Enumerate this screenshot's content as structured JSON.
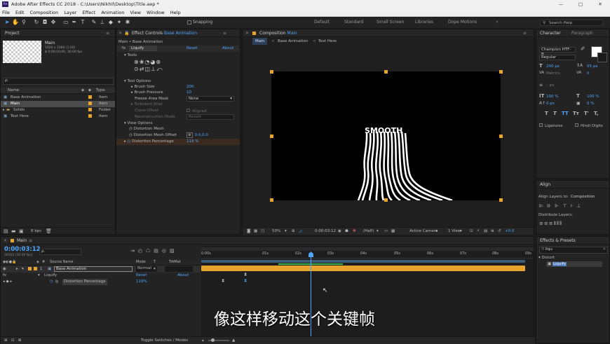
{
  "app": {
    "icon": "Ae",
    "title": "Adobe After Effects CC 2018 - C:\\Users\\Nikhil\\Desktop\\Title.aep *",
    "window_controls": {
      "minimize": "—",
      "maximize": "□",
      "close": "✕"
    }
  },
  "menu": [
    "File",
    "Edit",
    "Composition",
    "Layer",
    "Effect",
    "Animation",
    "View",
    "Window",
    "Help"
  ],
  "toolbar": {
    "tools": [
      "selection-arrow",
      "hand",
      "zoom",
      "rotate",
      "camera",
      "pan-behind",
      "rectangle",
      "pen",
      "type",
      "brush",
      "clone-stamp",
      "eraser",
      "roto-brush",
      "puppet"
    ],
    "snapping": "Snapping",
    "workspaces": [
      {
        "label": "Default",
        "active": false
      },
      {
        "label": "Standard",
        "active": false
      },
      {
        "label": "Small Screen",
        "active": false
      },
      {
        "label": "Libraries",
        "active": false
      },
      {
        "label": "Dope Motions",
        "active": false
      }
    ],
    "search_placeholder": "Search Help"
  },
  "project": {
    "tab": "Project",
    "item_name": "Main",
    "item_info1": "1920 x 1080 (1.00)",
    "item_info2": "Δ 0;00;10;00, 30.00 fps",
    "search_placeholder": "ρ.",
    "col_name": "Name",
    "col_type": "Type",
    "items": [
      {
        "name": "Base Animation",
        "type": "Item",
        "selected": false
      },
      {
        "name": "Main",
        "type": "Item",
        "selected": true
      },
      {
        "name": "Solids",
        "type": "Folder",
        "selected": false
      },
      {
        "name": "Text Here",
        "type": "Item",
        "selected": false
      }
    ],
    "bpc": "8 bpc"
  },
  "effect_controls": {
    "tab_prefix": "Effect Controls",
    "tab_layer": "Base Animation",
    "breadcrumb": "Main • Base Animation",
    "effect_name": "Liquify",
    "reset": "Reset",
    "about": "About",
    "tools_label": "Tools",
    "tool_options_label": "Tool Options",
    "brush_size_label": "Brush Size",
    "brush_size": "200",
    "brush_pressure_label": "Brush Pressure",
    "brush_pressure": "10",
    "freeze_label": "Freeze Area Mask",
    "freeze_value": "None",
    "turbulent_label": "Turbulent Jitter",
    "clone_offset_label": "Clone Offset",
    "aligned_label": "Aligned",
    "recon_label": "Reconstruction Mode",
    "recon_value": "Revert",
    "view_options_label": "View Options",
    "distortion_mesh_label": "Distortion Mesh",
    "mesh_offset_label": "Distortion Mesh Offset",
    "mesh_offset": "0.0,0.0",
    "distortion_pct_label": "Distortion Percentage",
    "distortion_pct": "119 %"
  },
  "composition": {
    "tab_prefix": "Composition",
    "tab_name": "Main",
    "nav": [
      "Main",
      "Base Animation",
      "Text Here"
    ],
    "canvas_text": "SMOOTH",
    "zoom": "50%",
    "timecode": "0:00:03:12",
    "resolution": "(Half)",
    "camera": "Active Camera",
    "views": "1 View",
    "exposure": "+0.0"
  },
  "character": {
    "tab": "Character",
    "tab2": "Paragraph",
    "font": "Champion HTF-B...",
    "style": "Regular",
    "size": "200 px",
    "leading": "55 px",
    "kerning": "Metrics",
    "tracking": "0",
    "stroke_unit": "– px",
    "vscale": "100 %",
    "hscale": "100 %",
    "baseline": "0 px",
    "tsume": "0 %",
    "style_buttons": [
      "T",
      "T",
      "TT",
      "Tт",
      "T'",
      "T,"
    ],
    "ligatures": "Ligatures",
    "hindi_digits": "Hindi Digits"
  },
  "align": {
    "tab": "Align",
    "align_to_label": "Align Layers to:",
    "align_to_value": "Composition",
    "distribute_label": "Distribute Layers:"
  },
  "effects_presets": {
    "tab": "Effects & Presets",
    "search_value": "liqu",
    "group": "Distort",
    "item": "Liquify"
  },
  "timeline": {
    "tab": "Main",
    "timecode": "0:00:03:12",
    "frame_info": "00102 (30.00 fps)",
    "search_placeholder": "ρ.",
    "col_source": "Source Name",
    "col_mode": "Mode",
    "col_trkmat": "TrkMat",
    "layer_index": "1",
    "layer_name": "Base Animation",
    "layer_mode": "Normal",
    "effect_name": "Liquify",
    "reset": "Reset",
    "about": "About",
    "prop_name": "Distortion Percentage",
    "prop_value": "119%",
    "ruler": [
      "0:00s",
      "01s",
      "02s",
      "03s",
      "04s",
      "05s",
      "06s",
      "07s",
      "08s",
      "09s",
      "10s"
    ],
    "toggle_label": "Toggle Switches / Modes"
  },
  "subtitle": "像这样移动这个关键帧",
  "colors": {
    "accent": "#4ea6ff",
    "layer_bar": "#e8a52e",
    "keyframe_green": "#3fb64a"
  }
}
